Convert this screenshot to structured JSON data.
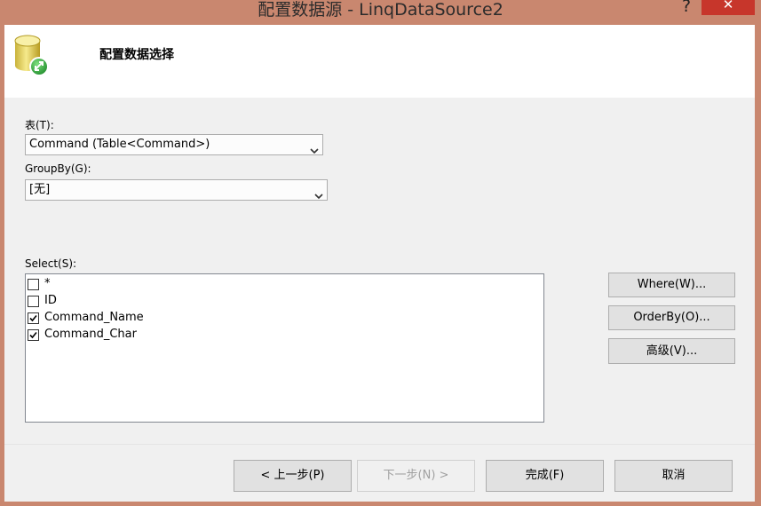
{
  "window": {
    "title": "配置数据源 - LinqDataSource2",
    "help_glyph": "?",
    "close_glyph": "✕"
  },
  "header": {
    "title": "配置数据选择",
    "icon": "database-icon"
  },
  "table_field": {
    "label": "表(T):",
    "value": "Command (Table<Command>)"
  },
  "groupby_field": {
    "label": "GroupBy(G):",
    "value": "[无]"
  },
  "select_field": {
    "label": "Select(S):",
    "items": [
      {
        "label": "*",
        "checked": false
      },
      {
        "label": "ID",
        "checked": false
      },
      {
        "label": "Command_Name",
        "checked": true
      },
      {
        "label": "Command_Char",
        "checked": true
      }
    ]
  },
  "side_buttons": {
    "where": "Where(W)...",
    "orderby": "OrderBy(O)...",
    "advanced": "高级(V)..."
  },
  "footer_buttons": {
    "prev": "< 上一步(P)",
    "next": "下一步(N) >",
    "finish": "完成(F)",
    "cancel": "取消"
  }
}
